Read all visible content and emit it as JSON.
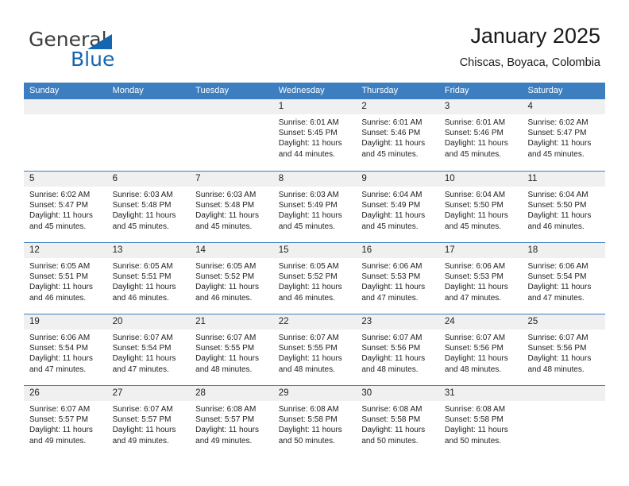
{
  "brand": {
    "name_top": "General",
    "name_bottom": "Blue",
    "triangle_color": "#1565b0"
  },
  "header": {
    "title": "January 2025",
    "subtitle": "Chiscas, Boyaca, Colombia"
  },
  "theme": {
    "header_blue": "#3c7ebf",
    "day_band_gray": "#f0f0f0",
    "text": "#222222"
  },
  "weekdays": [
    "Sunday",
    "Monday",
    "Tuesday",
    "Wednesday",
    "Thursday",
    "Friday",
    "Saturday"
  ],
  "labels": {
    "sunrise_prefix": "Sunrise:",
    "sunset_prefix": "Sunset:",
    "daylight_prefix": "Daylight:"
  },
  "weeks": [
    [
      {
        "day": "",
        "sunrise": "",
        "sunset": "",
        "daylight_line1": "",
        "daylight_line2": ""
      },
      {
        "day": "",
        "sunrise": "",
        "sunset": "",
        "daylight_line1": "",
        "daylight_line2": ""
      },
      {
        "day": "",
        "sunrise": "",
        "sunset": "",
        "daylight_line1": "",
        "daylight_line2": ""
      },
      {
        "day": "1",
        "sunrise": "Sunrise: 6:01 AM",
        "sunset": "Sunset: 5:45 PM",
        "daylight_line1": "Daylight: 11 hours",
        "daylight_line2": "and 44 minutes."
      },
      {
        "day": "2",
        "sunrise": "Sunrise: 6:01 AM",
        "sunset": "Sunset: 5:46 PM",
        "daylight_line1": "Daylight: 11 hours",
        "daylight_line2": "and 45 minutes."
      },
      {
        "day": "3",
        "sunrise": "Sunrise: 6:01 AM",
        "sunset": "Sunset: 5:46 PM",
        "daylight_line1": "Daylight: 11 hours",
        "daylight_line2": "and 45 minutes."
      },
      {
        "day": "4",
        "sunrise": "Sunrise: 6:02 AM",
        "sunset": "Sunset: 5:47 PM",
        "daylight_line1": "Daylight: 11 hours",
        "daylight_line2": "and 45 minutes."
      }
    ],
    [
      {
        "day": "5",
        "sunrise": "Sunrise: 6:02 AM",
        "sunset": "Sunset: 5:47 PM",
        "daylight_line1": "Daylight: 11 hours",
        "daylight_line2": "and 45 minutes."
      },
      {
        "day": "6",
        "sunrise": "Sunrise: 6:03 AM",
        "sunset": "Sunset: 5:48 PM",
        "daylight_line1": "Daylight: 11 hours",
        "daylight_line2": "and 45 minutes."
      },
      {
        "day": "7",
        "sunrise": "Sunrise: 6:03 AM",
        "sunset": "Sunset: 5:48 PM",
        "daylight_line1": "Daylight: 11 hours",
        "daylight_line2": "and 45 minutes."
      },
      {
        "day": "8",
        "sunrise": "Sunrise: 6:03 AM",
        "sunset": "Sunset: 5:49 PM",
        "daylight_line1": "Daylight: 11 hours",
        "daylight_line2": "and 45 minutes."
      },
      {
        "day": "9",
        "sunrise": "Sunrise: 6:04 AM",
        "sunset": "Sunset: 5:49 PM",
        "daylight_line1": "Daylight: 11 hours",
        "daylight_line2": "and 45 minutes."
      },
      {
        "day": "10",
        "sunrise": "Sunrise: 6:04 AM",
        "sunset": "Sunset: 5:50 PM",
        "daylight_line1": "Daylight: 11 hours",
        "daylight_line2": "and 45 minutes."
      },
      {
        "day": "11",
        "sunrise": "Sunrise: 6:04 AM",
        "sunset": "Sunset: 5:50 PM",
        "daylight_line1": "Daylight: 11 hours",
        "daylight_line2": "and 46 minutes."
      }
    ],
    [
      {
        "day": "12",
        "sunrise": "Sunrise: 6:05 AM",
        "sunset": "Sunset: 5:51 PM",
        "daylight_line1": "Daylight: 11 hours",
        "daylight_line2": "and 46 minutes."
      },
      {
        "day": "13",
        "sunrise": "Sunrise: 6:05 AM",
        "sunset": "Sunset: 5:51 PM",
        "daylight_line1": "Daylight: 11 hours",
        "daylight_line2": "and 46 minutes."
      },
      {
        "day": "14",
        "sunrise": "Sunrise: 6:05 AM",
        "sunset": "Sunset: 5:52 PM",
        "daylight_line1": "Daylight: 11 hours",
        "daylight_line2": "and 46 minutes."
      },
      {
        "day": "15",
        "sunrise": "Sunrise: 6:05 AM",
        "sunset": "Sunset: 5:52 PM",
        "daylight_line1": "Daylight: 11 hours",
        "daylight_line2": "and 46 minutes."
      },
      {
        "day": "16",
        "sunrise": "Sunrise: 6:06 AM",
        "sunset": "Sunset: 5:53 PM",
        "daylight_line1": "Daylight: 11 hours",
        "daylight_line2": "and 47 minutes."
      },
      {
        "day": "17",
        "sunrise": "Sunrise: 6:06 AM",
        "sunset": "Sunset: 5:53 PM",
        "daylight_line1": "Daylight: 11 hours",
        "daylight_line2": "and 47 minutes."
      },
      {
        "day": "18",
        "sunrise": "Sunrise: 6:06 AM",
        "sunset": "Sunset: 5:54 PM",
        "daylight_line1": "Daylight: 11 hours",
        "daylight_line2": "and 47 minutes."
      }
    ],
    [
      {
        "day": "19",
        "sunrise": "Sunrise: 6:06 AM",
        "sunset": "Sunset: 5:54 PM",
        "daylight_line1": "Daylight: 11 hours",
        "daylight_line2": "and 47 minutes."
      },
      {
        "day": "20",
        "sunrise": "Sunrise: 6:07 AM",
        "sunset": "Sunset: 5:54 PM",
        "daylight_line1": "Daylight: 11 hours",
        "daylight_line2": "and 47 minutes."
      },
      {
        "day": "21",
        "sunrise": "Sunrise: 6:07 AM",
        "sunset": "Sunset: 5:55 PM",
        "daylight_line1": "Daylight: 11 hours",
        "daylight_line2": "and 48 minutes."
      },
      {
        "day": "22",
        "sunrise": "Sunrise: 6:07 AM",
        "sunset": "Sunset: 5:55 PM",
        "daylight_line1": "Daylight: 11 hours",
        "daylight_line2": "and 48 minutes."
      },
      {
        "day": "23",
        "sunrise": "Sunrise: 6:07 AM",
        "sunset": "Sunset: 5:56 PM",
        "daylight_line1": "Daylight: 11 hours",
        "daylight_line2": "and 48 minutes."
      },
      {
        "day": "24",
        "sunrise": "Sunrise: 6:07 AM",
        "sunset": "Sunset: 5:56 PM",
        "daylight_line1": "Daylight: 11 hours",
        "daylight_line2": "and 48 minutes."
      },
      {
        "day": "25",
        "sunrise": "Sunrise: 6:07 AM",
        "sunset": "Sunset: 5:56 PM",
        "daylight_line1": "Daylight: 11 hours",
        "daylight_line2": "and 48 minutes."
      }
    ],
    [
      {
        "day": "26",
        "sunrise": "Sunrise: 6:07 AM",
        "sunset": "Sunset: 5:57 PM",
        "daylight_line1": "Daylight: 11 hours",
        "daylight_line2": "and 49 minutes."
      },
      {
        "day": "27",
        "sunrise": "Sunrise: 6:07 AM",
        "sunset": "Sunset: 5:57 PM",
        "daylight_line1": "Daylight: 11 hours",
        "daylight_line2": "and 49 minutes."
      },
      {
        "day": "28",
        "sunrise": "Sunrise: 6:08 AM",
        "sunset": "Sunset: 5:57 PM",
        "daylight_line1": "Daylight: 11 hours",
        "daylight_line2": "and 49 minutes."
      },
      {
        "day": "29",
        "sunrise": "Sunrise: 6:08 AM",
        "sunset": "Sunset: 5:58 PM",
        "daylight_line1": "Daylight: 11 hours",
        "daylight_line2": "and 50 minutes."
      },
      {
        "day": "30",
        "sunrise": "Sunrise: 6:08 AM",
        "sunset": "Sunset: 5:58 PM",
        "daylight_line1": "Daylight: 11 hours",
        "daylight_line2": "and 50 minutes."
      },
      {
        "day": "31",
        "sunrise": "Sunrise: 6:08 AM",
        "sunset": "Sunset: 5:58 PM",
        "daylight_line1": "Daylight: 11 hours",
        "daylight_line2": "and 50 minutes."
      },
      {
        "day": "",
        "sunrise": "",
        "sunset": "",
        "daylight_line1": "",
        "daylight_line2": ""
      }
    ]
  ]
}
